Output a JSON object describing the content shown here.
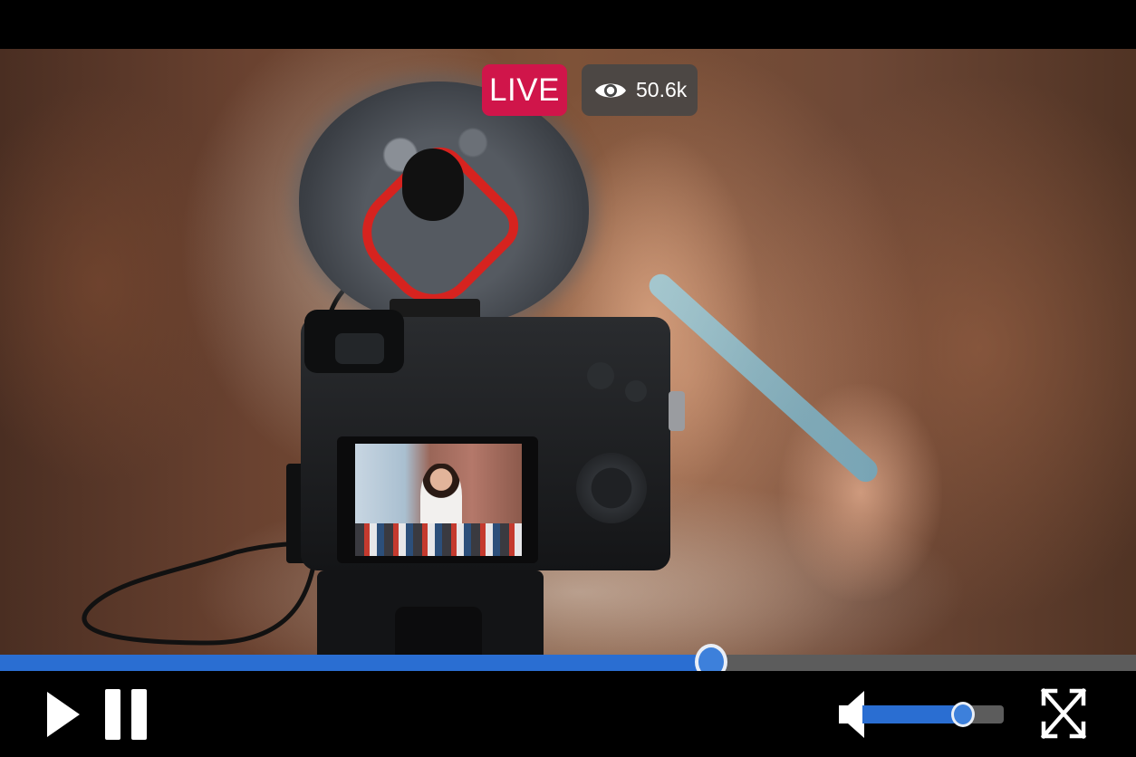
{
  "overlay": {
    "live_label": "LIVE",
    "viewer_count": "50.6k",
    "live_color": "#d0154a"
  },
  "player": {
    "progress_fraction": 0.626,
    "volume_fraction": 0.71,
    "accent_color": "#2a6ed2",
    "icons": [
      "eye-icon",
      "play-icon",
      "pause-icon",
      "volume-icon",
      "fullscreen-icon"
    ]
  }
}
